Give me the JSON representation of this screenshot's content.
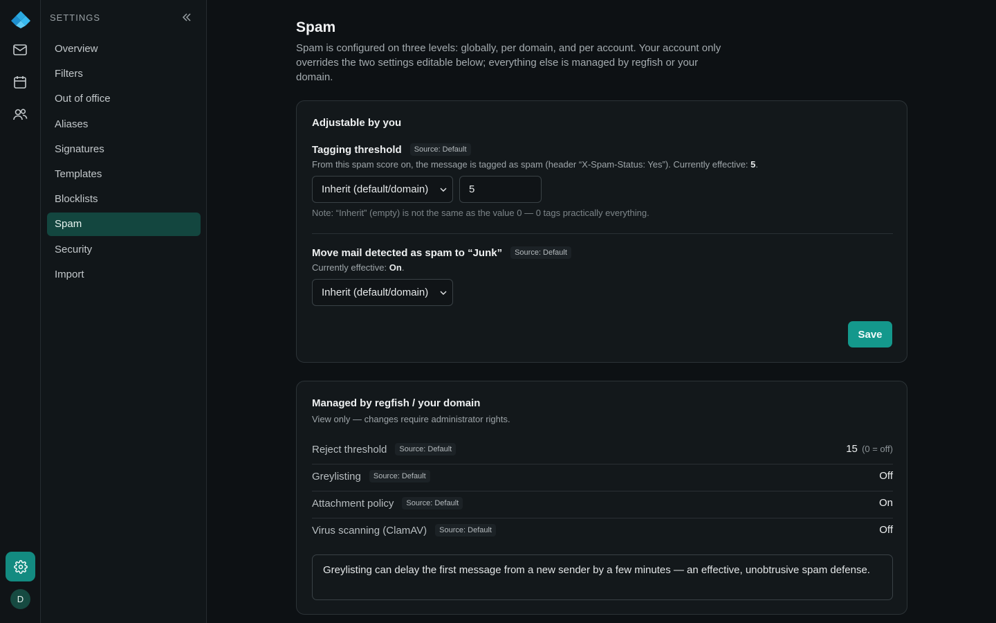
{
  "rail": {
    "avatar_initial": "D",
    "icons": [
      "app-logo",
      "mail-icon",
      "calendar-icon",
      "contacts-icon",
      "gear-icon"
    ],
    "accent": "#138b81"
  },
  "sidebar": {
    "heading": "SETTINGS",
    "items": [
      {
        "label": "Overview"
      },
      {
        "label": "Filters"
      },
      {
        "label": "Out of office"
      },
      {
        "label": "Aliases"
      },
      {
        "label": "Signatures"
      },
      {
        "label": "Templates"
      },
      {
        "label": "Blocklists"
      },
      {
        "label": "Spam",
        "active": true
      },
      {
        "label": "Security"
      },
      {
        "label": "Import"
      }
    ]
  },
  "page": {
    "title": "Spam",
    "description": "Spam is configured on three levels: globally, per domain, and per account. Your account only overrides the two settings editable below; everything else is managed by regfish or your domain."
  },
  "adjustable": {
    "title": "Adjustable by you",
    "tagging": {
      "label": "Tagging threshold",
      "source": "Source: Default",
      "help_prefix": "From this spam score on, the message is tagged as spam (header “X-Spam-Status: Yes”). Currently effective: ",
      "effective": "5",
      "help_suffix": ".",
      "select_value": "Inherit (default/domain)",
      "input_value": "5",
      "note": "Note: “Inherit” (empty) is not the same as the value 0 — 0 tags practically everything."
    },
    "junk": {
      "label": "Move mail detected as spam to “Junk”",
      "source": "Source: Default",
      "help_prefix": "Currently effective: ",
      "effective": "On",
      "help_suffix": ".",
      "select_value": "Inherit (default/domain)"
    },
    "save_label": "Save"
  },
  "managed": {
    "title": "Managed by regfish / your domain",
    "subtitle": "View only — changes require administrator rights.",
    "rows": [
      {
        "label": "Reject threshold",
        "source": "Source: Default",
        "value": "15",
        "hint": "(0 = off)"
      },
      {
        "label": "Greylisting",
        "source": "Source: Default",
        "value": "Off"
      },
      {
        "label": "Attachment policy",
        "source": "Source: Default",
        "value": "On"
      },
      {
        "label": "Virus scanning (ClamAV)",
        "source": "Source: Default",
        "value": "Off"
      }
    ],
    "info": "Greylisting can delay the first message from a new sender by a few minutes — an effective, unobtrusive spam defense."
  }
}
